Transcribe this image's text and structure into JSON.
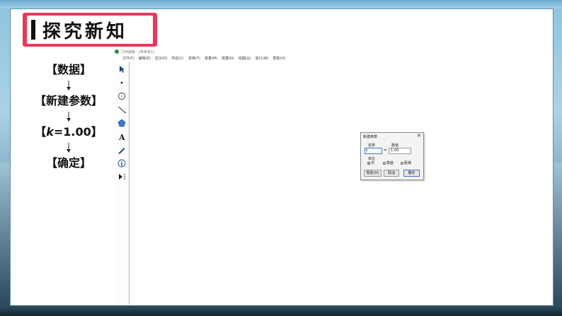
{
  "section_title": "探究新知",
  "steps": [
    "【数据】",
    "【新建参数】",
    "【",
    "k",
    "=1.00】",
    "【确定】"
  ],
  "app": {
    "window_title": "几何画板 - [未命名1]",
    "menu": [
      "文件(F)",
      "编辑(E)",
      "显示(D)",
      "构造(C)",
      "变换(T)",
      "度量(M)",
      "数据(N)",
      "绘图(G)",
      "窗口(W)",
      "帮助(H)"
    ],
    "tools": [
      "selection-arrow-icon",
      "point-icon",
      "compass-icon",
      "straightedge-icon",
      "polygon-icon",
      "text-icon",
      "marker-icon",
      "information-icon",
      "custom-tool-icon"
    ]
  },
  "dialog": {
    "title": "新建参数",
    "close": "✕",
    "name_label": "名称",
    "value_label": "数值",
    "name_value": "k",
    "equals": "=",
    "value": "1.00",
    "unit_label": "单位",
    "units": [
      "无",
      "角度",
      "距离"
    ],
    "selected_unit": "无",
    "buttons": [
      "帮助(H)",
      "取消",
      "确定"
    ]
  },
  "colors": {
    "badge": "#e8385a",
    "accent_blue": "#3a78c8"
  }
}
